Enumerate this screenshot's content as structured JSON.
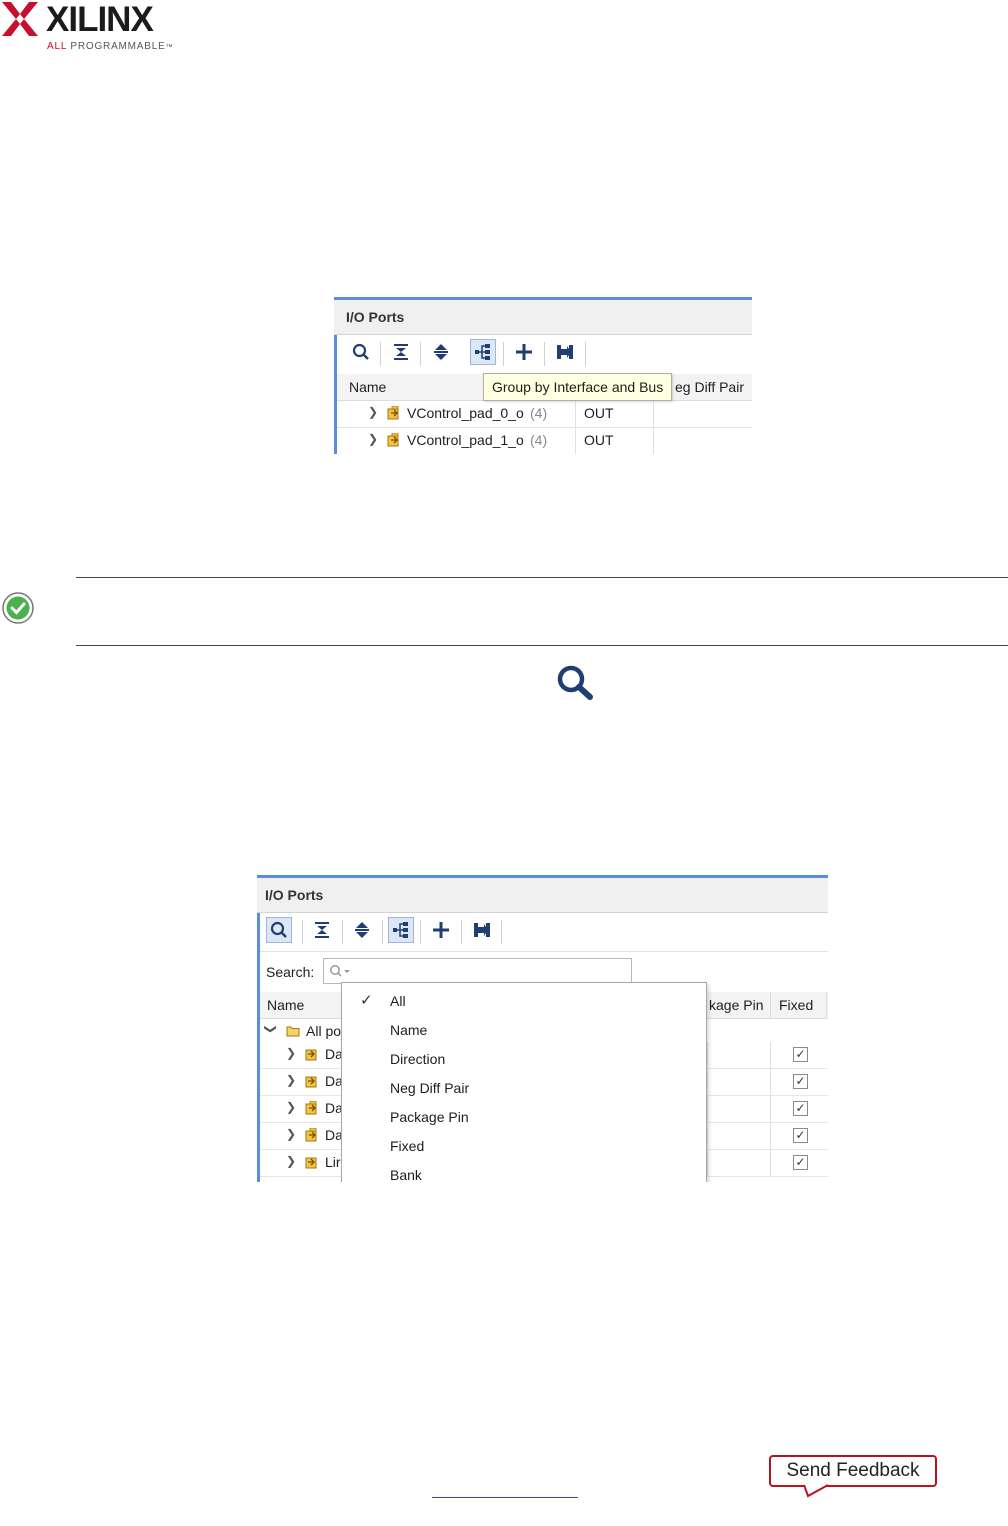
{
  "logo": {
    "word": "XILINX",
    "tagline_red": "ALL",
    "tagline_rest": " PROGRAMMABLE",
    "tm": "™"
  },
  "colors": {
    "accent_blue": "#5b8dd9",
    "xilinx_red": "#c8102e",
    "feedback_border": "#b8141e",
    "tooltip_bg": "#ffffe1",
    "success_green": "#4caf50"
  },
  "panel1": {
    "title": "I/O Ports",
    "toolbar_icons": [
      "search-icon",
      "collapse-all-icon",
      "expand-all-icon",
      "group-by-interface-icon",
      "add-icon",
      "export-icon"
    ],
    "tooltip": "Group by Interface and Bus",
    "headers": {
      "name": "Name",
      "neg_diff_pair": "eg Diff Pair"
    },
    "rows": [
      {
        "name": "VControl_pad_0_o",
        "count": "(4)",
        "direction": "OUT"
      },
      {
        "name": "VControl_pad_1_o",
        "count": "(4)",
        "direction": "OUT"
      }
    ]
  },
  "note": {
    "icon": "check-circle-icon"
  },
  "inline_icon": "search-icon",
  "panel2": {
    "title": "I/O Ports",
    "search_label": "Search:",
    "search_value": "",
    "headers": {
      "name": "Name",
      "package_pin": "kage Pin",
      "fixed": "Fixed"
    },
    "root_row": "All po",
    "rows": [
      {
        "name": "Da",
        "fixed": true
      },
      {
        "name": "Da",
        "fixed": true
      },
      {
        "name": "Da",
        "fixed": true
      },
      {
        "name": "Da",
        "fixed": true
      },
      {
        "name": "Lir",
        "fixed": true
      }
    ],
    "menu": {
      "selected": "All",
      "items": [
        "All",
        "Name",
        "Direction",
        "Neg Diff Pair",
        "Package Pin",
        "Fixed",
        "Bank"
      ]
    }
  },
  "footer": {
    "feedback": "Send Feedback"
  }
}
